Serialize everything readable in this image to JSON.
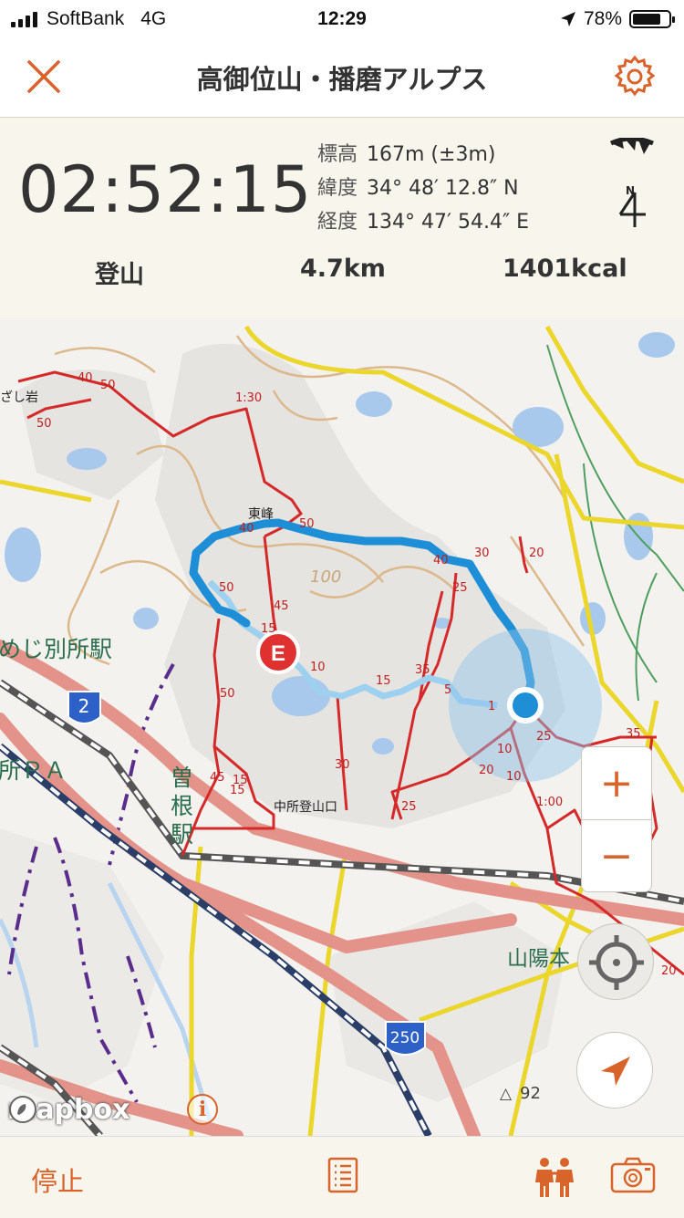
{
  "status_bar": {
    "carrier": "SoftBank",
    "network": "4G",
    "time": "12:29",
    "battery": "78%",
    "battery_level": 0.78
  },
  "nav": {
    "title": "高御位山・播磨アルプス"
  },
  "info": {
    "elapsed": "02:52:15",
    "altitude_label": "標高",
    "altitude_value": "167m (±3m)",
    "latitude_label": "緯度",
    "latitude_value": "34° 48′ 12.8″ N",
    "longitude_label": "経度",
    "longitude_value": "134° 47′ 54.4″ E",
    "compass_label": "N",
    "mode": "登山",
    "distance": "4.7km",
    "calories": "1401kcal"
  },
  "map": {
    "labels": {
      "station": "めじ別所駅",
      "pa": "所ＰＡ",
      "sone": "曽根駅",
      "sanyo": "山陽本",
      "east_peak": "東峰",
      "trailhead": "中所登山口",
      "rock": "ざし岩",
      "contour": "100",
      "summit": "92",
      "route2": "2",
      "route250": "250",
      "t_130": "1:30",
      "t_100": "1:00",
      "n10": "10",
      "n15": "15",
      "n15b": "15",
      "n15c": "15",
      "n15d": "15",
      "n30": "30",
      "n50": "50",
      "n5": "5",
      "n10b": "10",
      "n10c": "10",
      "n25": "25",
      "n35": "35",
      "n20": "20",
      "n40": "40",
      "n50b": "50",
      "n45": "45",
      "n30b": "30",
      "n45b": "45",
      "n25b": "25",
      "n40b": "40",
      "n20b": "20",
      "n25c": "25",
      "n20c": "20",
      "n35b": "35",
      "n20d": "20",
      "n40c": "40",
      "n50c": "50",
      "n50d": "50",
      "n15e": "15",
      "n45c": "45",
      "n1": "1"
    },
    "end_marker": "E",
    "zoom_in": "+",
    "zoom_out": "−",
    "brand": "mapbox",
    "attribution_glyph": "i",
    "accuracy_color": "#8ec4ea",
    "track_color": "#1e8ed6",
    "trail_color": "#d42a2a"
  },
  "tab_bar": {
    "stop_label": "停止"
  },
  "colors": {
    "accent": "#d8642b"
  }
}
